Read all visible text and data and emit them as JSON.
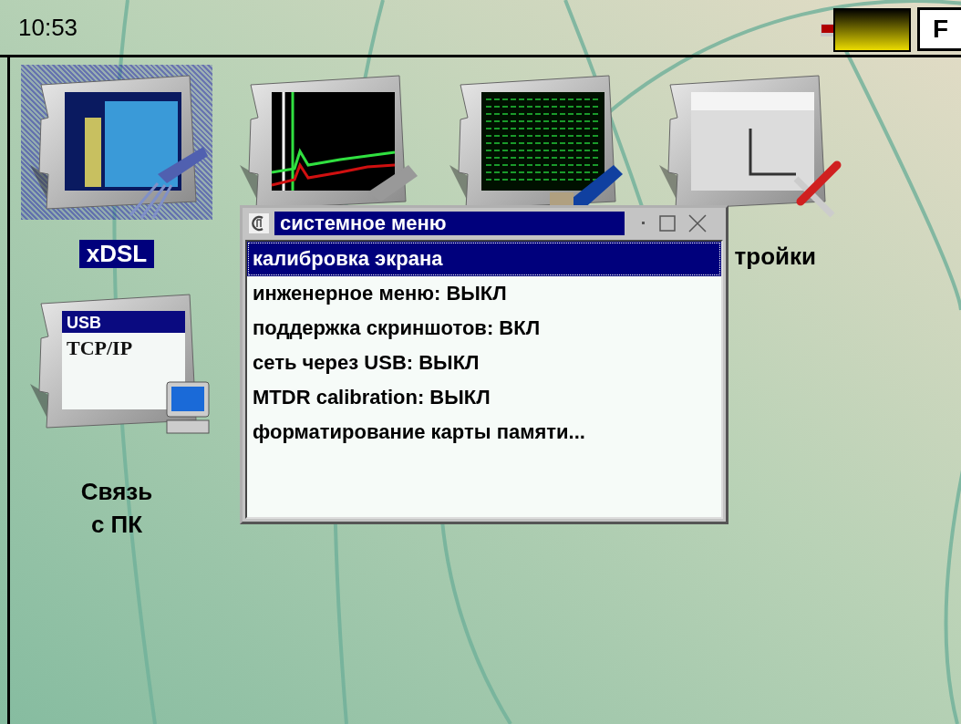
{
  "status_bar": {
    "time": "10:53",
    "key_label": "F"
  },
  "desktop": {
    "icons": [
      {
        "kind": "xdsl",
        "label": "xDSL",
        "selected": true
      },
      {
        "kind": "reflectometer",
        "selected": false
      },
      {
        "kind": "network",
        "selected": false
      },
      {
        "kind": "settings",
        "label": "тройки",
        "selected": false
      },
      {
        "kind": "pc-link",
        "label": "Связь\nс ПК",
        "selected": false,
        "screen_texts": [
          "USB",
          "TCP/IP"
        ]
      }
    ]
  },
  "dialog": {
    "title": "системное меню",
    "items": [
      {
        "label": "калибровка экрана",
        "selected": true
      },
      {
        "label": "инженерное меню: ВЫКЛ",
        "selected": false
      },
      {
        "label": "поддержка скриншотов: ВКЛ",
        "selected": false
      },
      {
        "label": "сеть через USB: ВЫКЛ",
        "selected": false
      },
      {
        "label": "MTDR calibration: ВЫКЛ",
        "selected": false
      },
      {
        "label": "форматирование карты памяти...",
        "selected": false
      }
    ]
  }
}
